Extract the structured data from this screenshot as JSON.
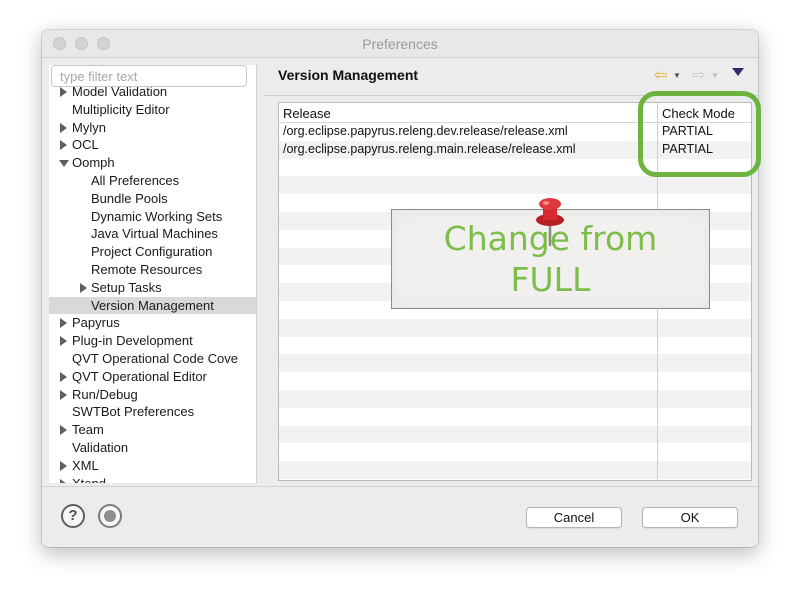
{
  "window": {
    "title": "Preferences"
  },
  "filter": {
    "placeholder": "type filter text"
  },
  "tree": [
    {
      "label": "Model Validation",
      "level": 0,
      "arrow": "right",
      "clipped": true
    },
    {
      "label": "Multiplicity Editor",
      "level": 0,
      "arrow": "none"
    },
    {
      "label": "Mylyn",
      "level": 0,
      "arrow": "right"
    },
    {
      "label": "OCL",
      "level": 0,
      "arrow": "right"
    },
    {
      "label": "Oomph",
      "level": 0,
      "arrow": "down"
    },
    {
      "label": "All Preferences",
      "level": 1,
      "arrow": "none"
    },
    {
      "label": "Bundle Pools",
      "level": 1,
      "arrow": "none"
    },
    {
      "label": "Dynamic Working Sets",
      "level": 1,
      "arrow": "none"
    },
    {
      "label": "Java Virtual Machines",
      "level": 1,
      "arrow": "none"
    },
    {
      "label": "Project Configuration",
      "level": 1,
      "arrow": "none"
    },
    {
      "label": "Remote Resources",
      "level": 1,
      "arrow": "none"
    },
    {
      "label": "Setup Tasks",
      "level": 1,
      "arrow": "right"
    },
    {
      "label": "Version Management",
      "level": 1,
      "arrow": "none",
      "selected": true
    },
    {
      "label": "Papyrus",
      "level": 0,
      "arrow": "right"
    },
    {
      "label": "Plug-in Development",
      "level": 0,
      "arrow": "right"
    },
    {
      "label": "QVT Operational Code Cove",
      "level": 0,
      "arrow": "none"
    },
    {
      "label": "QVT Operational Editor",
      "level": 0,
      "arrow": "right"
    },
    {
      "label": "Run/Debug",
      "level": 0,
      "arrow": "right"
    },
    {
      "label": "SWTBot Preferences",
      "level": 0,
      "arrow": "none"
    },
    {
      "label": "Team",
      "level": 0,
      "arrow": "right"
    },
    {
      "label": "Validation",
      "level": 0,
      "arrow": "none"
    },
    {
      "label": "XML",
      "level": 0,
      "arrow": "right"
    },
    {
      "label": "Xtend",
      "level": 0,
      "arrow": "right",
      "clipped": true
    }
  ],
  "page": {
    "title": "Version Management"
  },
  "table": {
    "columns": [
      "Release",
      "Check Mode"
    ],
    "rows": [
      [
        "/org.eclipse.papyrus.releng.dev.release/release.xml",
        "PARTIAL"
      ],
      [
        "/org.eclipse.papyrus.releng.main.release/release.xml",
        "PARTIAL"
      ]
    ]
  },
  "annotation": {
    "line1": "Change from",
    "line2": "FULL",
    "color": "#7dbd4a",
    "highlight_color": "#6cb43f"
  },
  "buttons": {
    "help": "?",
    "cancel": "Cancel",
    "ok": "OK"
  }
}
